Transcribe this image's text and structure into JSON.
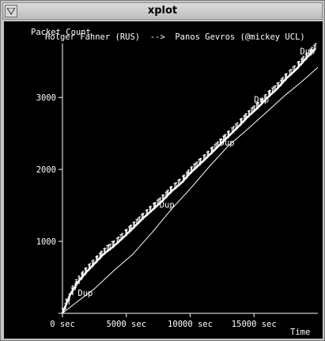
{
  "window": {
    "title": "xplot"
  },
  "plot": {
    "ylabel": "Packet Count",
    "header": "Holger Fahner (RUS)  -->  Panos Gevros (@mickey UCL)",
    "xlabel": "Time",
    "dup_label": "Dup"
  },
  "chart_data": {
    "type": "scatter",
    "title": "Holger Fahner (RUS)  -->  Panos Gevros (@mickey UCL)",
    "xlabel": "Time",
    "ylabel": "Packet Count",
    "x_ticks": [
      "0 sec",
      "5000 sec",
      "10000 sec",
      "15000 sec"
    ],
    "y_ticks": [
      "1000",
      "2000",
      "3000"
    ],
    "xlim": [
      0,
      20000
    ],
    "ylim": [
      0,
      3750
    ],
    "series": [
      {
        "marker": "segments",
        "color": "#ffffff",
        "x": [
          0,
          600,
          1200,
          1800,
          2500,
          3200,
          4000,
          4800,
          5500,
          6300,
          7000,
          7800,
          8500,
          9300,
          10000,
          10800,
          11500,
          12300,
          13000,
          13800,
          14500,
          15300,
          16000,
          16800,
          17500,
          18300,
          19000,
          19800
        ],
        "y": [
          0,
          260,
          430,
          560,
          690,
          820,
          930,
          1060,
          1180,
          1320,
          1430,
          1560,
          1690,
          1810,
          1950,
          2080,
          2200,
          2340,
          2460,
          2600,
          2730,
          2860,
          2990,
          3120,
          3260,
          3390,
          3530,
          3680
        ]
      },
      {
        "marker": "line",
        "color": "#ffffff",
        "x": [
          0,
          1000,
          2500,
          4000,
          5500,
          7000,
          8500,
          10000,
          11500,
          13000,
          14500,
          16000,
          17500,
          19000,
          20000
        ],
        "y": [
          0,
          140,
          340,
          590,
          820,
          1120,
          1440,
          1730,
          2040,
          2330,
          2560,
          2800,
          3040,
          3260,
          3420
        ]
      }
    ],
    "annotations": [
      {
        "text": "Dup",
        "x": 1200,
        "y": 240
      },
      {
        "text": "Dup",
        "x": 7600,
        "y": 1470
      },
      {
        "text": "Dup",
        "x": 12300,
        "y": 2330
      },
      {
        "text": "Dup",
        "x": 15000,
        "y": 2930
      },
      {
        "text": "Dup",
        "x": 18600,
        "y": 3600
      }
    ]
  }
}
